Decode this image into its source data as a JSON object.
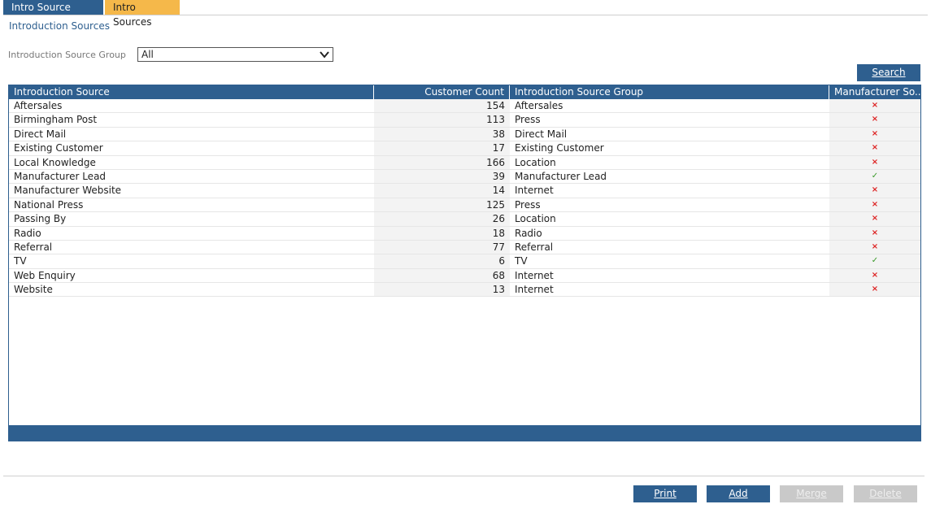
{
  "tabs": [
    {
      "label": "Intro Source Groups"
    },
    {
      "label": "Intro Sources"
    }
  ],
  "page_title": "Introduction Sources",
  "filter": {
    "label": "Introduction Source Group",
    "value": "All"
  },
  "search_label": "Search",
  "table": {
    "headers": [
      "Introduction Source",
      "Customer Count",
      "Introduction Source Group",
      "Manufacturer So..."
    ],
    "rows": [
      {
        "source": "Aftersales",
        "count": "154",
        "group": "Aftersales",
        "mark": "×",
        "manufacturer": false
      },
      {
        "source": "Birmingham Post",
        "count": "113",
        "group": "Press",
        "mark": "×",
        "manufacturer": false
      },
      {
        "source": "Direct Mail",
        "count": "38",
        "group": "Direct Mail",
        "mark": "×",
        "manufacturer": false
      },
      {
        "source": "Existing Customer",
        "count": "17",
        "group": "Existing Customer",
        "mark": "×",
        "manufacturer": false
      },
      {
        "source": "Local Knowledge",
        "count": "166",
        "group": "Location",
        "mark": "×",
        "manufacturer": false
      },
      {
        "source": "Manufacturer Lead",
        "count": "39",
        "group": "Manufacturer Lead",
        "mark": "✓",
        "manufacturer": true
      },
      {
        "source": "Manufacturer Website",
        "count": "14",
        "group": "Internet",
        "mark": "×",
        "manufacturer": false
      },
      {
        "source": "National Press",
        "count": "125",
        "group": "Press",
        "mark": "×",
        "manufacturer": false
      },
      {
        "source": "Passing By",
        "count": "26",
        "group": "Location",
        "mark": "×",
        "manufacturer": false
      },
      {
        "source": "Radio",
        "count": "18",
        "group": "Radio",
        "mark": "×",
        "manufacturer": false
      },
      {
        "source": "Referral",
        "count": "77",
        "group": "Referral",
        "mark": "×",
        "manufacturer": false
      },
      {
        "source": "TV",
        "count": "6",
        "group": "TV",
        "mark": "✓",
        "manufacturer": true
      },
      {
        "source": "Web Enquiry",
        "count": "68",
        "group": "Internet",
        "mark": "×",
        "manufacturer": false
      },
      {
        "source": "Website",
        "count": "13",
        "group": "Internet",
        "mark": "×",
        "manufacturer": false
      }
    ]
  },
  "actions": {
    "print": "Print",
    "add": "Add",
    "merge": "Merge",
    "delete": "Delete"
  },
  "colors": {
    "primary": "#2e5f8f",
    "active_tab": "#f5b84a",
    "disabled": "#c9c9c9",
    "cross": "#dd2222",
    "check": "#3a9a2a"
  }
}
